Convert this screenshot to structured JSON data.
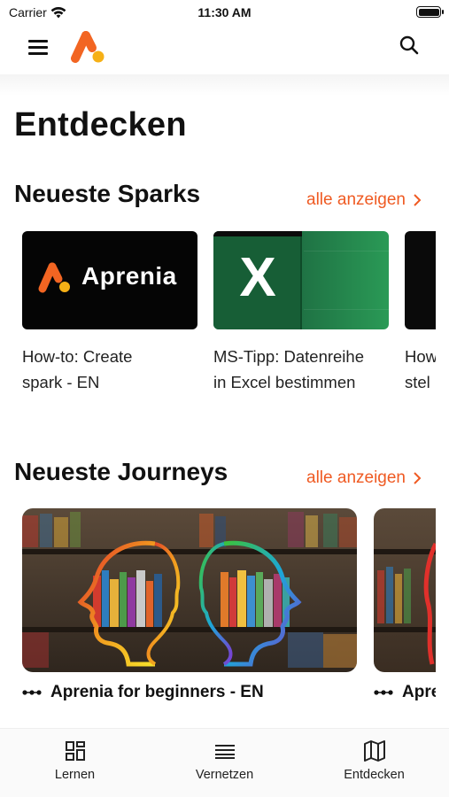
{
  "status_bar": {
    "carrier": "Carrier",
    "time": "11:30 AM"
  },
  "nav": {
    "menu_icon": "hamburger-icon",
    "logo_icon": "aprenia-logo-icon",
    "search_icon": "search-icon"
  },
  "page_title": "Entdecken",
  "sparks": {
    "title": "Neueste Sparks",
    "see_all": "alle anzeigen",
    "items": [
      {
        "thumb_text": "Aprenia",
        "caption_line1": "How-to: Create",
        "caption_line2": "spark - EN"
      },
      {
        "thumb_text": "X",
        "caption_line1": "MS-Tipp: Datenreihe",
        "caption_line2": "in Excel bestimmen"
      },
      {
        "thumb_text": "",
        "caption_line1": "How",
        "caption_line2": "stel"
      }
    ]
  },
  "journeys": {
    "title": "Neueste Journeys",
    "see_all": "alle anzeigen",
    "items": [
      {
        "caption": "Aprenia for beginners - EN",
        "icon": "path-dots-icon"
      },
      {
        "caption": "Apre",
        "icon": "path-dots-icon"
      }
    ]
  },
  "tabs": [
    {
      "label": "Lernen",
      "icon": "grid-icon"
    },
    {
      "label": "Vernetzen",
      "icon": "list-lines-icon"
    },
    {
      "label": "Entdecken",
      "icon": "map-icon"
    }
  ],
  "colors": {
    "accent": "#ef5a22",
    "logo_orange": "#f26522",
    "logo_yellow": "#f6b016",
    "excel_green": "#1f7244"
  }
}
